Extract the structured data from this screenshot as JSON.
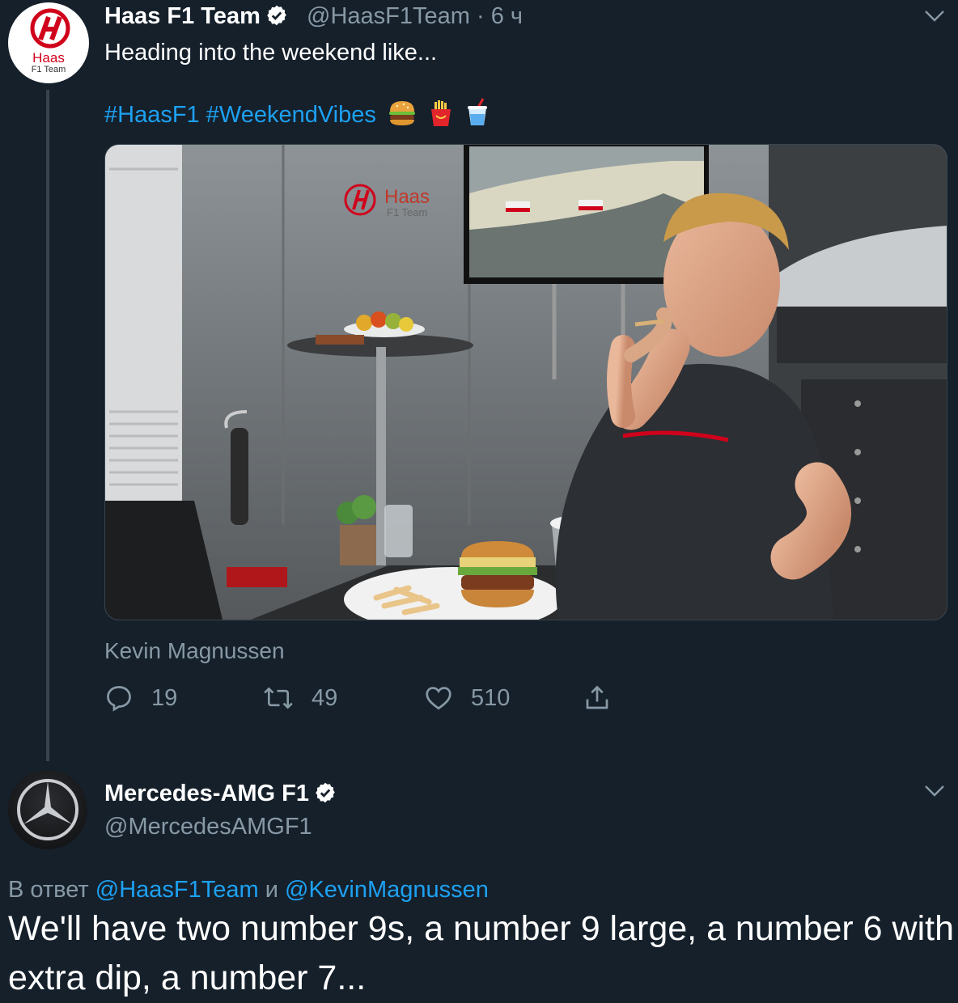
{
  "tweet1": {
    "author_name": "Haas F1 Team",
    "author_handle": "@HaasF1Team",
    "separator": " · ",
    "time": "6 ч",
    "avatar_text_1": "Haas",
    "avatar_text_2": "F1 Team",
    "text": "Heading into the weekend like...",
    "hashtags": "#HaasF1 #WeekendVibes",
    "emoji": [
      "burger",
      "fries",
      "cup-with-straw"
    ],
    "media_caption": "Kevin Magnussen",
    "media_logo_1": "Haas",
    "media_logo_2": "F1 Team",
    "actions": {
      "replies": "19",
      "retweets": "49",
      "likes": "510"
    }
  },
  "tweet2": {
    "author_name": "Mercedes-AMG F1",
    "author_handle": "@MercedesAMGF1",
    "reply_prefix": "В ответ ",
    "reply_mention_1": "@HaasF1Team",
    "reply_and": " и ",
    "reply_mention_2": "@KevinMagnussen",
    "text": "We'll have two number 9s, a number 9 large, a number 6 with extra dip, a number 7..."
  },
  "colors": {
    "background": "#15202b",
    "accent": "#1da1f2",
    "secondary_text": "#8899a6",
    "haas_red": "#d0021b"
  }
}
